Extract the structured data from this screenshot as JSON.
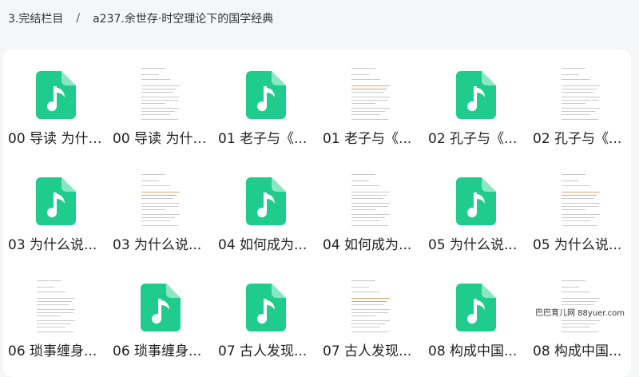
{
  "breadcrumb": {
    "parent": "3.完结栏目",
    "separator": "/",
    "current": "a237.余世存·时空理论下的国学经典"
  },
  "colors": {
    "audio_icon": "#1fcc8e",
    "panel_bg": "#ffffff",
    "page_bg": "#f5f6f8"
  },
  "files": [
    {
      "name": "00 导读 为什么...",
      "kind": "audio",
      "icon": "music-file-icon"
    },
    {
      "name": "00 导读 为什么...",
      "kind": "doc",
      "icon": "document-thumbnail"
    },
    {
      "name": "01 老子与《...",
      "kind": "audio",
      "icon": "music-file-icon"
    },
    {
      "name": "01 老子与《...",
      "kind": "doc",
      "icon": "document-thumbnail"
    },
    {
      "name": "02 孔子与《...",
      "kind": "audio",
      "icon": "music-file-icon"
    },
    {
      "name": "02 孔子与《...",
      "kind": "doc",
      "icon": "document-thumbnail"
    },
    {
      "name": "03 为什么说...",
      "kind": "audio",
      "icon": "music-file-icon"
    },
    {
      "name": "03 为什么说...",
      "kind": "doc",
      "icon": "document-thumbnail"
    },
    {
      "name": "04 如何成为...",
      "kind": "audio",
      "icon": "music-file-icon"
    },
    {
      "name": "04 如何成为...",
      "kind": "doc",
      "icon": "document-thumbnail"
    },
    {
      "name": "05 为什么说...",
      "kind": "audio",
      "icon": "music-file-icon"
    },
    {
      "name": "05 为什么说...",
      "kind": "doc",
      "icon": "document-thumbnail"
    },
    {
      "name": "06 琐事缠身...",
      "kind": "doc",
      "icon": "document-thumbnail"
    },
    {
      "name": "06 琐事缠身...",
      "kind": "audio",
      "icon": "music-file-icon"
    },
    {
      "name": "07 古人发现...",
      "kind": "audio",
      "icon": "music-file-icon"
    },
    {
      "name": "07 古人发现...",
      "kind": "doc",
      "icon": "document-thumbnail"
    },
    {
      "name": "08 构成中国...",
      "kind": "audio",
      "icon": "music-file-icon"
    },
    {
      "name": "08 构成中国...",
      "kind": "doc",
      "icon": "document-thumbnail"
    }
  ],
  "watermark": "巴巴育儿网 88yuer.com"
}
